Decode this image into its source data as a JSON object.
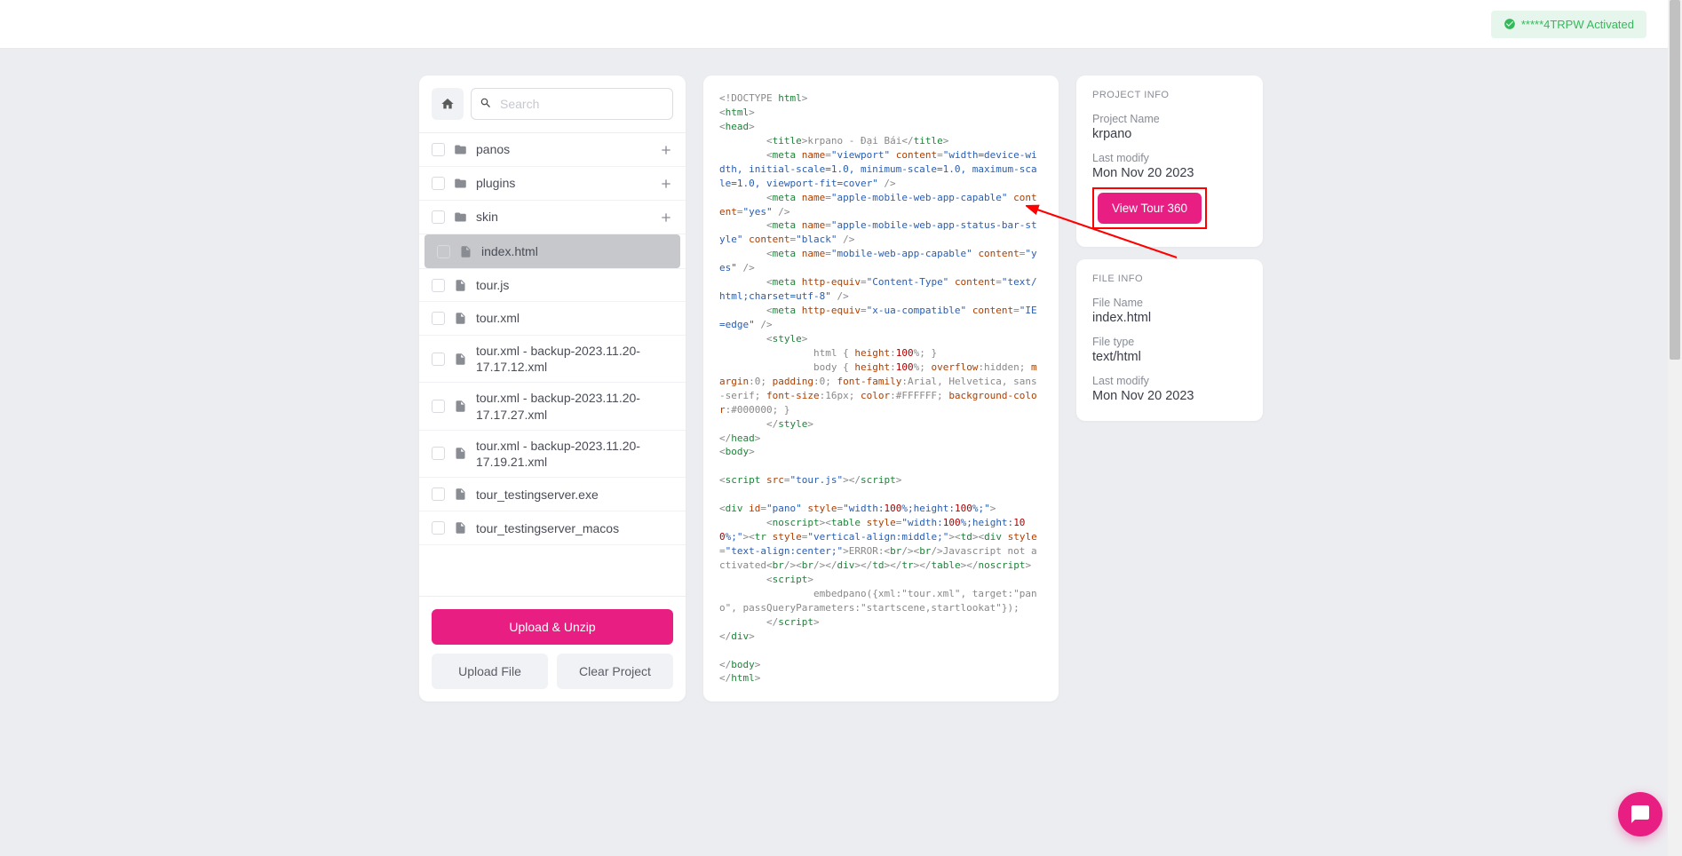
{
  "topbar": {
    "activation_text": "*****4TRPW Activated"
  },
  "search": {
    "placeholder": "Search"
  },
  "tree": {
    "folders": [
      {
        "name": "panos",
        "expandable": true
      },
      {
        "name": "plugins",
        "expandable": true
      },
      {
        "name": "skin",
        "expandable": true
      }
    ],
    "files": [
      {
        "name": "index.html",
        "selected": true
      },
      {
        "name": "tour.js"
      },
      {
        "name": "tour.xml"
      },
      {
        "name": "tour.xml - backup-2023.11.20-17.17.12.xml"
      },
      {
        "name": "tour.xml - backup-2023.11.20-17.17.27.xml"
      },
      {
        "name": "tour.xml - backup-2023.11.20-17.19.21.xml"
      },
      {
        "name": "tour_testingserver.exe"
      },
      {
        "name": "tour_testingserver_macos"
      }
    ]
  },
  "buttons": {
    "upload_unzip": "Upload & Unzip",
    "upload_file": "Upload File",
    "clear_project": "Clear Project"
  },
  "project_info": {
    "title": "PROJECT INFO",
    "name_label": "Project Name",
    "name_value": "krpano",
    "modify_label": "Last modify",
    "modify_value": "Mon Nov 20 2023",
    "view_button": "View Tour 360"
  },
  "file_info": {
    "title": "FILE INFO",
    "name_label": "File Name",
    "name_value": "index.html",
    "type_label": "File type",
    "type_value": "text/html",
    "modify_label": "Last modify",
    "modify_value": "Mon Nov 20 2023"
  }
}
